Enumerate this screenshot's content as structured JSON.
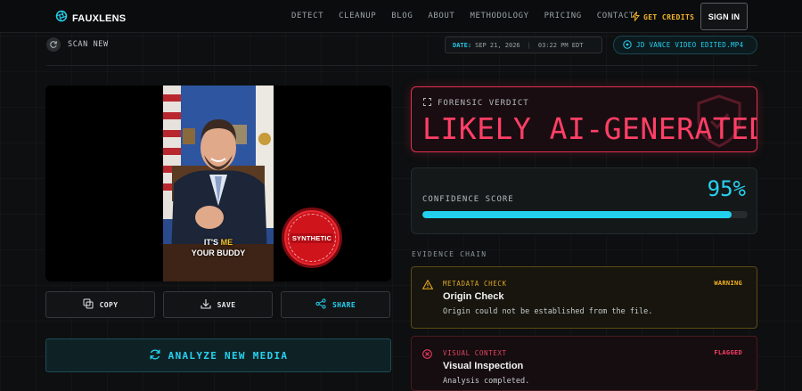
{
  "brand": {
    "name": "FAUXLENS"
  },
  "nav": {
    "links": [
      "DETECT",
      "CLEANUP",
      "BLOG",
      "ABOUT",
      "METHODOLOGY",
      "PRICING",
      "CONTACT"
    ],
    "get_credits": "GET CREDITS",
    "sign_in": "SIGN IN"
  },
  "subbar": {
    "scan_new": "SCAN NEW",
    "date_key": "DATE:",
    "date_value": "SEP 21, 2026",
    "time_value": "03:22 PM EDT",
    "filename": "JD VANCE VIDEO EDITED.MP4"
  },
  "media": {
    "caption_line1_a": "IT'S ",
    "caption_line1_b": "ME",
    "caption_line2": "YOUR BUDDY",
    "badge_label": "SYNTHETIC"
  },
  "actions": {
    "copy": "COPY",
    "save": "SAVE",
    "share": "SHARE"
  },
  "analyze_label": "ANALYZE NEW MEDIA",
  "verdict": {
    "label": "FORENSIC VERDICT",
    "value": "LIKELY AI-GENERATED"
  },
  "confidence": {
    "label": "CONFIDENCE SCORE",
    "display": "95%",
    "fill_percent": 95
  },
  "evidence": {
    "title": "EVIDENCE CHAIN",
    "items": [
      {
        "category": "METADATA CHECK",
        "status": "WARNING",
        "title": "Origin Check",
        "description": "Origin could not be established from the file."
      },
      {
        "category": "VISUAL CONTEXT",
        "status": "FLAGGED",
        "title": "Visual Inspection",
        "description": "Analysis completed."
      }
    ]
  },
  "colors": {
    "accent": "#22d0ee",
    "danger": "#ff3f66",
    "warning": "#f2b21f",
    "background": "#0d0f10"
  },
  "icons": {
    "logo": "aperture-icon",
    "credits": "lightning-icon",
    "scan": "refresh-icon",
    "file": "film-icon",
    "copy": "copy-icon",
    "save": "download-icon",
    "share": "share-icon",
    "analyze": "refresh-icon",
    "verdict": "scan-frame-icon",
    "verdict_bg": "shield-icon",
    "warning": "warning-triangle-icon",
    "flagged": "x-circle-icon"
  }
}
